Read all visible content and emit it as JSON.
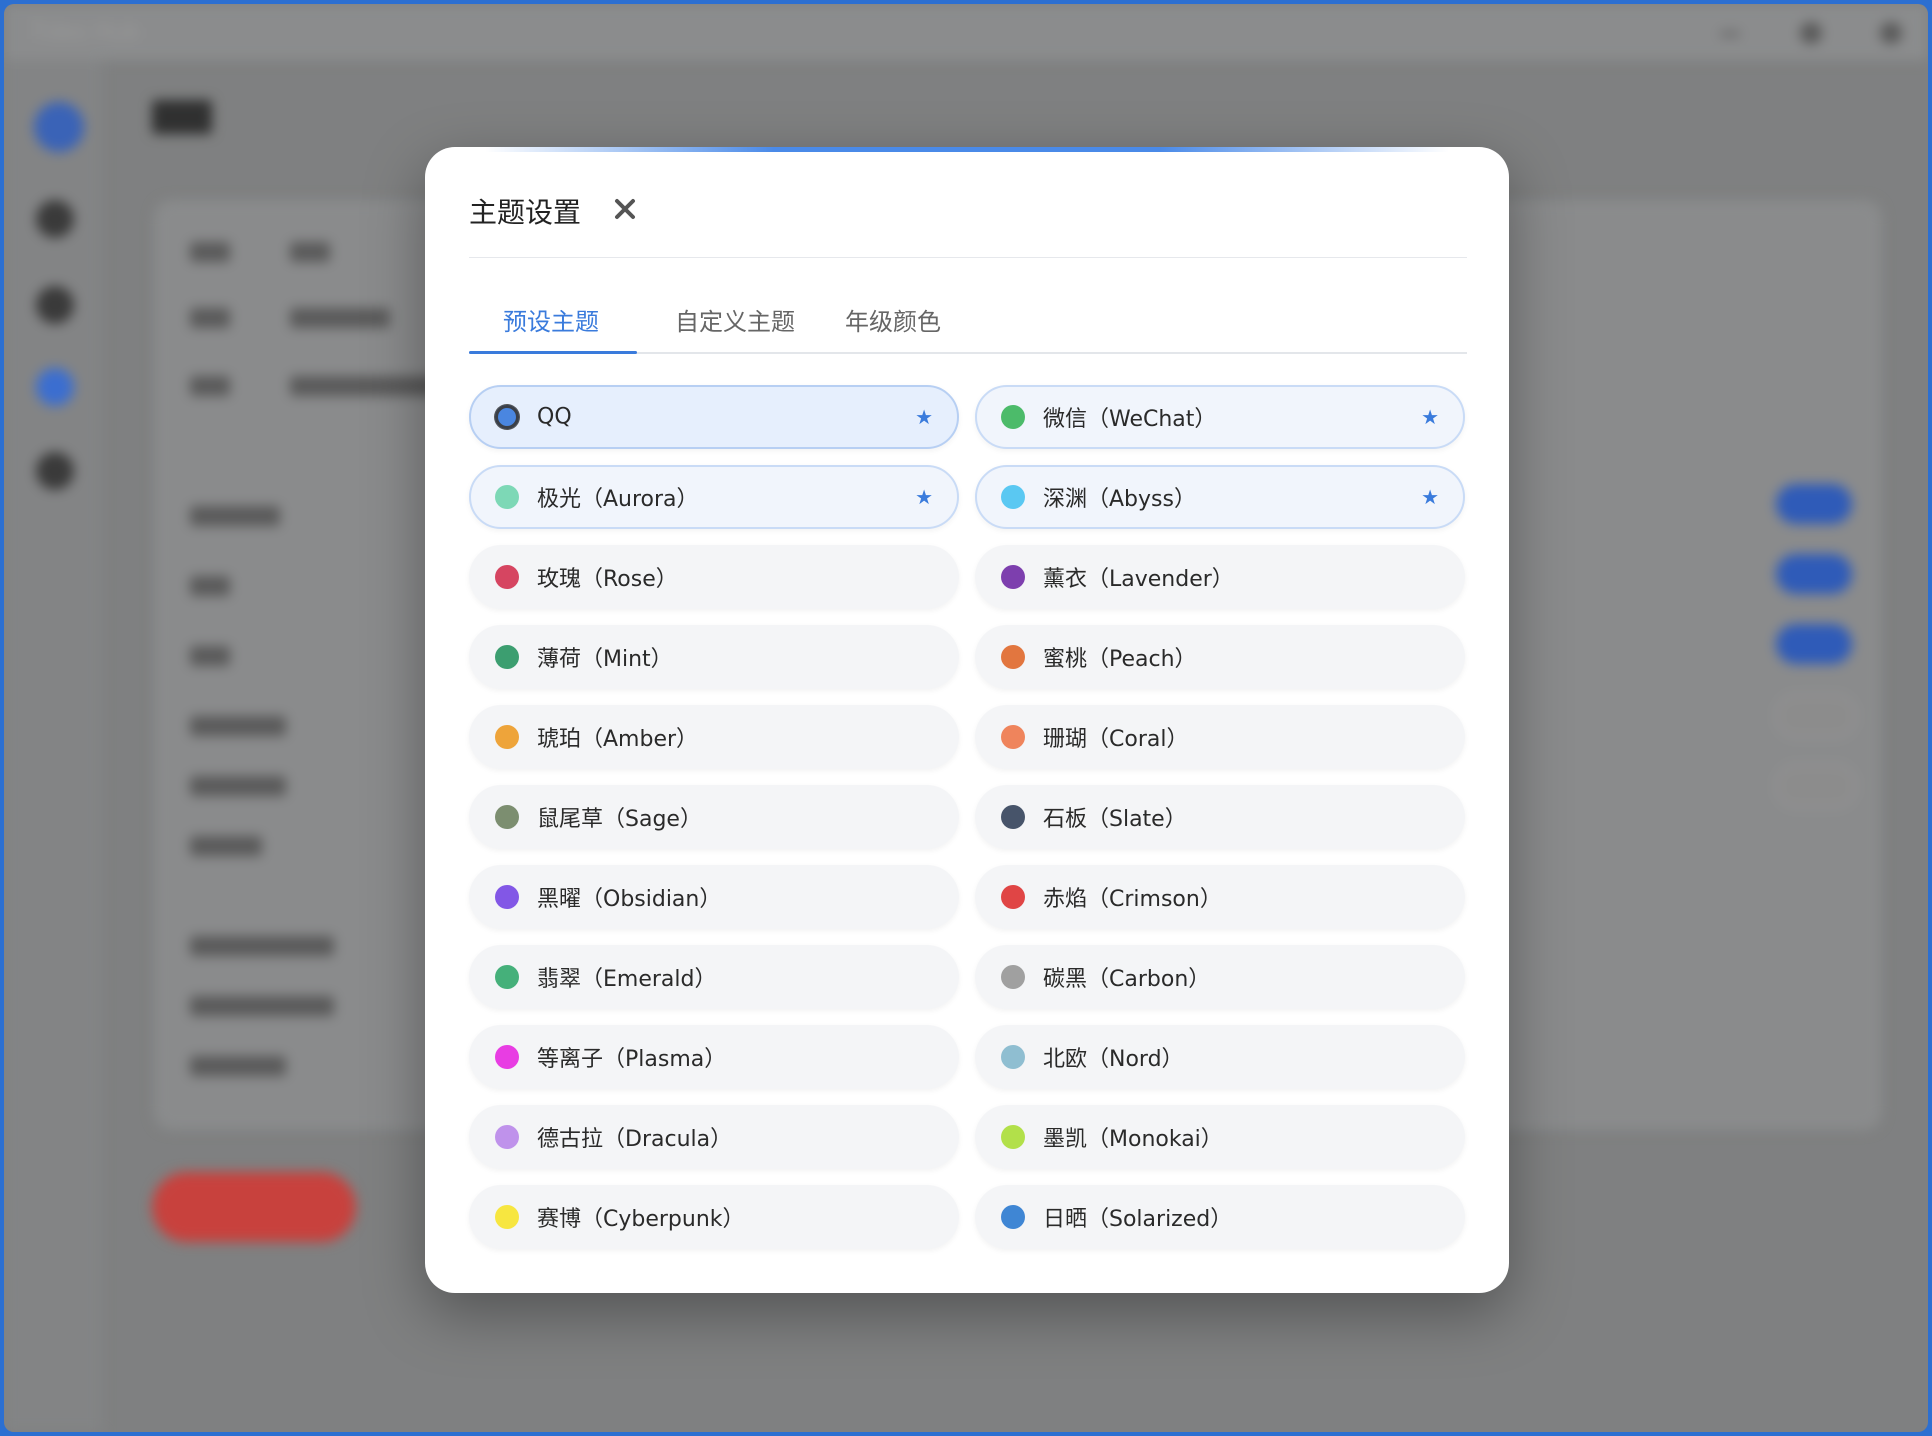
{
  "background": {
    "app_title": "Tides Hub",
    "page_title": "设置"
  },
  "modal": {
    "title": "主题设置",
    "tabs": [
      {
        "label": "预设主题",
        "active": true
      },
      {
        "label": "自定义主题",
        "active": false
      },
      {
        "label": "年级颜色",
        "active": false
      }
    ],
    "star_glyph": "★",
    "themes": [
      {
        "name": "QQ",
        "color": "#4a86e0",
        "favorite": true,
        "selected": true
      },
      {
        "name": "微信（WeChat）",
        "color": "#4cbb6a",
        "favorite": true,
        "selected": false
      },
      {
        "name": "极光（Aurora）",
        "color": "#7dd8b6",
        "favorite": true,
        "selected": false
      },
      {
        "name": "深渊（Abyss）",
        "color": "#5ac8f2",
        "favorite": true,
        "selected": false
      },
      {
        "name": "玫瑰（Rose）",
        "color": "#d64561",
        "favorite": false,
        "selected": false
      },
      {
        "name": "薰衣（Lavender）",
        "color": "#7d3fae",
        "favorite": false,
        "selected": false
      },
      {
        "name": "薄荷（Mint）",
        "color": "#3c9e70",
        "favorite": false,
        "selected": false
      },
      {
        "name": "蜜桃（Peach）",
        "color": "#e2763f",
        "favorite": false,
        "selected": false
      },
      {
        "name": "琥珀（Amber）",
        "color": "#eea43a",
        "favorite": false,
        "selected": false
      },
      {
        "name": "珊瑚（Coral）",
        "color": "#ef845c",
        "favorite": false,
        "selected": false
      },
      {
        "name": "鼠尾草（Sage）",
        "color": "#7c8e70",
        "favorite": false,
        "selected": false
      },
      {
        "name": "石板（Slate）",
        "color": "#47546a",
        "favorite": false,
        "selected": false
      },
      {
        "name": "黑曜（Obsidian）",
        "color": "#8257e6",
        "favorite": false,
        "selected": false
      },
      {
        "name": "赤焰（Crimson）",
        "color": "#e04545",
        "favorite": false,
        "selected": false
      },
      {
        "name": "翡翠（Emerald）",
        "color": "#45b07a",
        "favorite": false,
        "selected": false
      },
      {
        "name": "碳黑（Carbon）",
        "color": "#a0a0a0",
        "favorite": false,
        "selected": false
      },
      {
        "name": "等离子（Plasma）",
        "color": "#e83de3",
        "favorite": false,
        "selected": false
      },
      {
        "name": "北欧（Nord）",
        "color": "#8fbed1",
        "favorite": false,
        "selected": false
      },
      {
        "name": "德古拉（Dracula）",
        "color": "#bf92eb",
        "favorite": false,
        "selected": false
      },
      {
        "name": "墨凯（Monokai）",
        "color": "#b2e04a",
        "favorite": false,
        "selected": false
      },
      {
        "name": "赛博（Cyberpunk）",
        "color": "#f7e640",
        "favorite": false,
        "selected": false
      },
      {
        "name": "日晒（Solarized）",
        "color": "#3f86d4",
        "favorite": false,
        "selected": false
      }
    ]
  }
}
